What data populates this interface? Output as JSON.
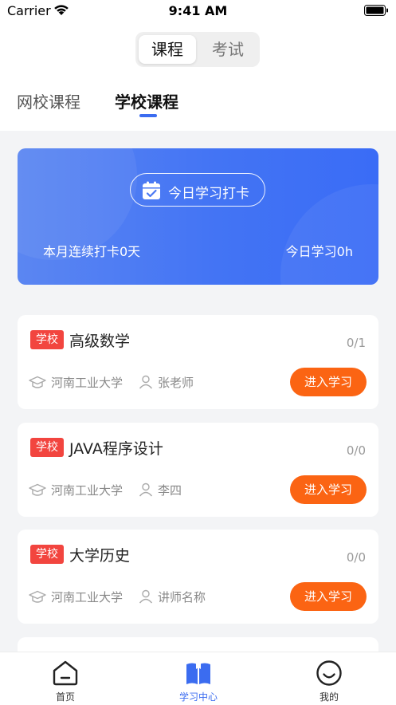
{
  "status_bar": {
    "carrier": "Carrier",
    "time": "9:41 AM"
  },
  "segment": {
    "items": [
      "课程",
      "考试"
    ],
    "selected": 0
  },
  "sub_tabs": {
    "items": [
      "网校课程",
      "学校课程"
    ],
    "active": 1,
    "accent_color": "#3b6cf0"
  },
  "banner": {
    "checkin_label": "今日学习打卡",
    "month_streak": "本月连续打卡0天",
    "today_study": "今日学习0h",
    "gradient_colors": [
      "#5b86f2",
      "#3a6cf6"
    ]
  },
  "courses": [
    {
      "badge": "学校",
      "title": "高级数学",
      "progress": "0/1",
      "school": "河南工业大学",
      "teacher": "张老师",
      "action": "进入学习"
    },
    {
      "badge": "学校",
      "title": "JAVA程序设计",
      "progress": "0/0",
      "school": "河南工业大学",
      "teacher": "李四",
      "action": "进入学习"
    },
    {
      "badge": "学校",
      "title": "大学历史",
      "progress": "0/0",
      "school": "河南工业大学",
      "teacher": "讲师名称",
      "action": "进入学习"
    }
  ],
  "colors": {
    "badge": "#f2453f",
    "action_button": "#fb6413",
    "accent": "#3b6cf0"
  },
  "tab_bar": {
    "items": [
      {
        "label": "首页",
        "icon": "home-icon"
      },
      {
        "label": "学习中心",
        "icon": "book-icon"
      },
      {
        "label": "我的",
        "icon": "profile-icon"
      }
    ],
    "active": 1
  }
}
